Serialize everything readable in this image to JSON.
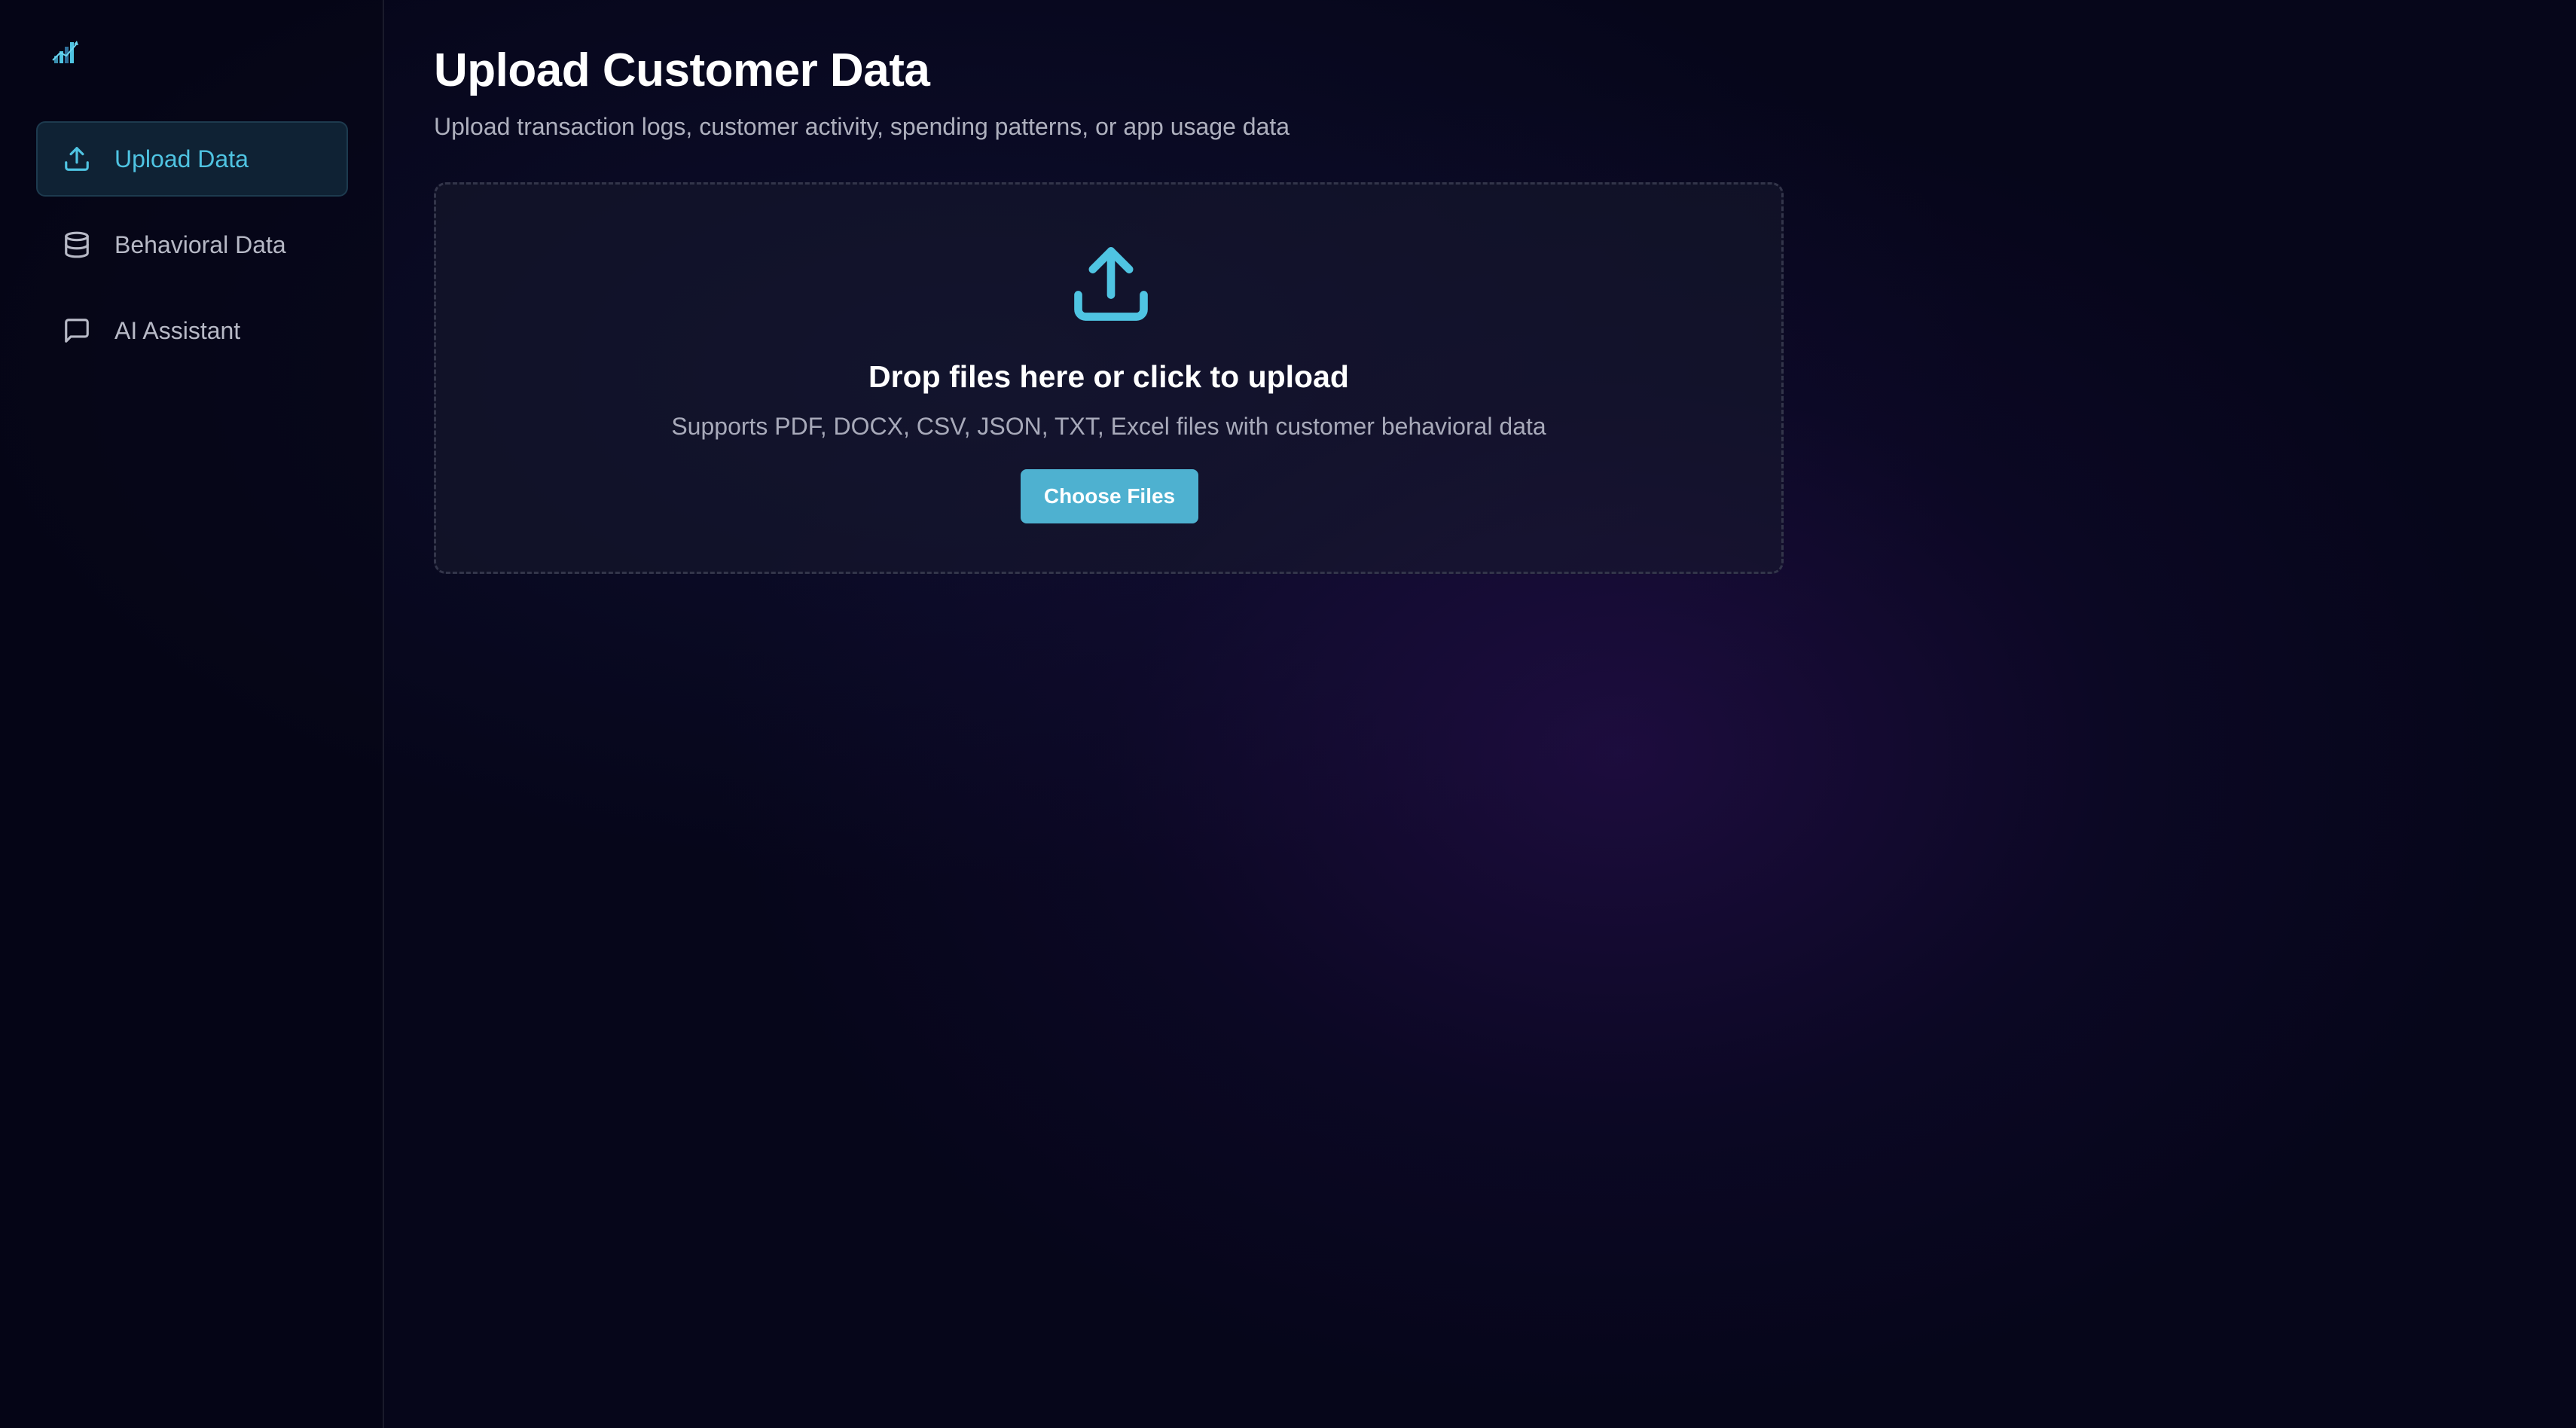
{
  "app": {
    "logo_icon": "chart-bars-logo-icon",
    "accent_color": "#4fc4e2",
    "button_color": "#4eb1d0"
  },
  "sidebar": {
    "items": [
      {
        "label": "Upload Data",
        "icon": "upload-icon",
        "active": true
      },
      {
        "label": "Behavioral Data",
        "icon": "database-icon",
        "active": false
      },
      {
        "label": "AI Assistant",
        "icon": "message-square-icon",
        "active": false
      }
    ]
  },
  "main": {
    "title": "Upload Customer Data",
    "subtitle": "Upload transaction logs, customer activity, spending patterns, or app usage data",
    "dropzone": {
      "icon": "upload-icon",
      "title": "Drop files here or click to upload",
      "subtitle": "Supports PDF, DOCX, CSV, JSON, TXT, Excel files with customer behavioral data",
      "button_label": "Choose Files"
    }
  }
}
